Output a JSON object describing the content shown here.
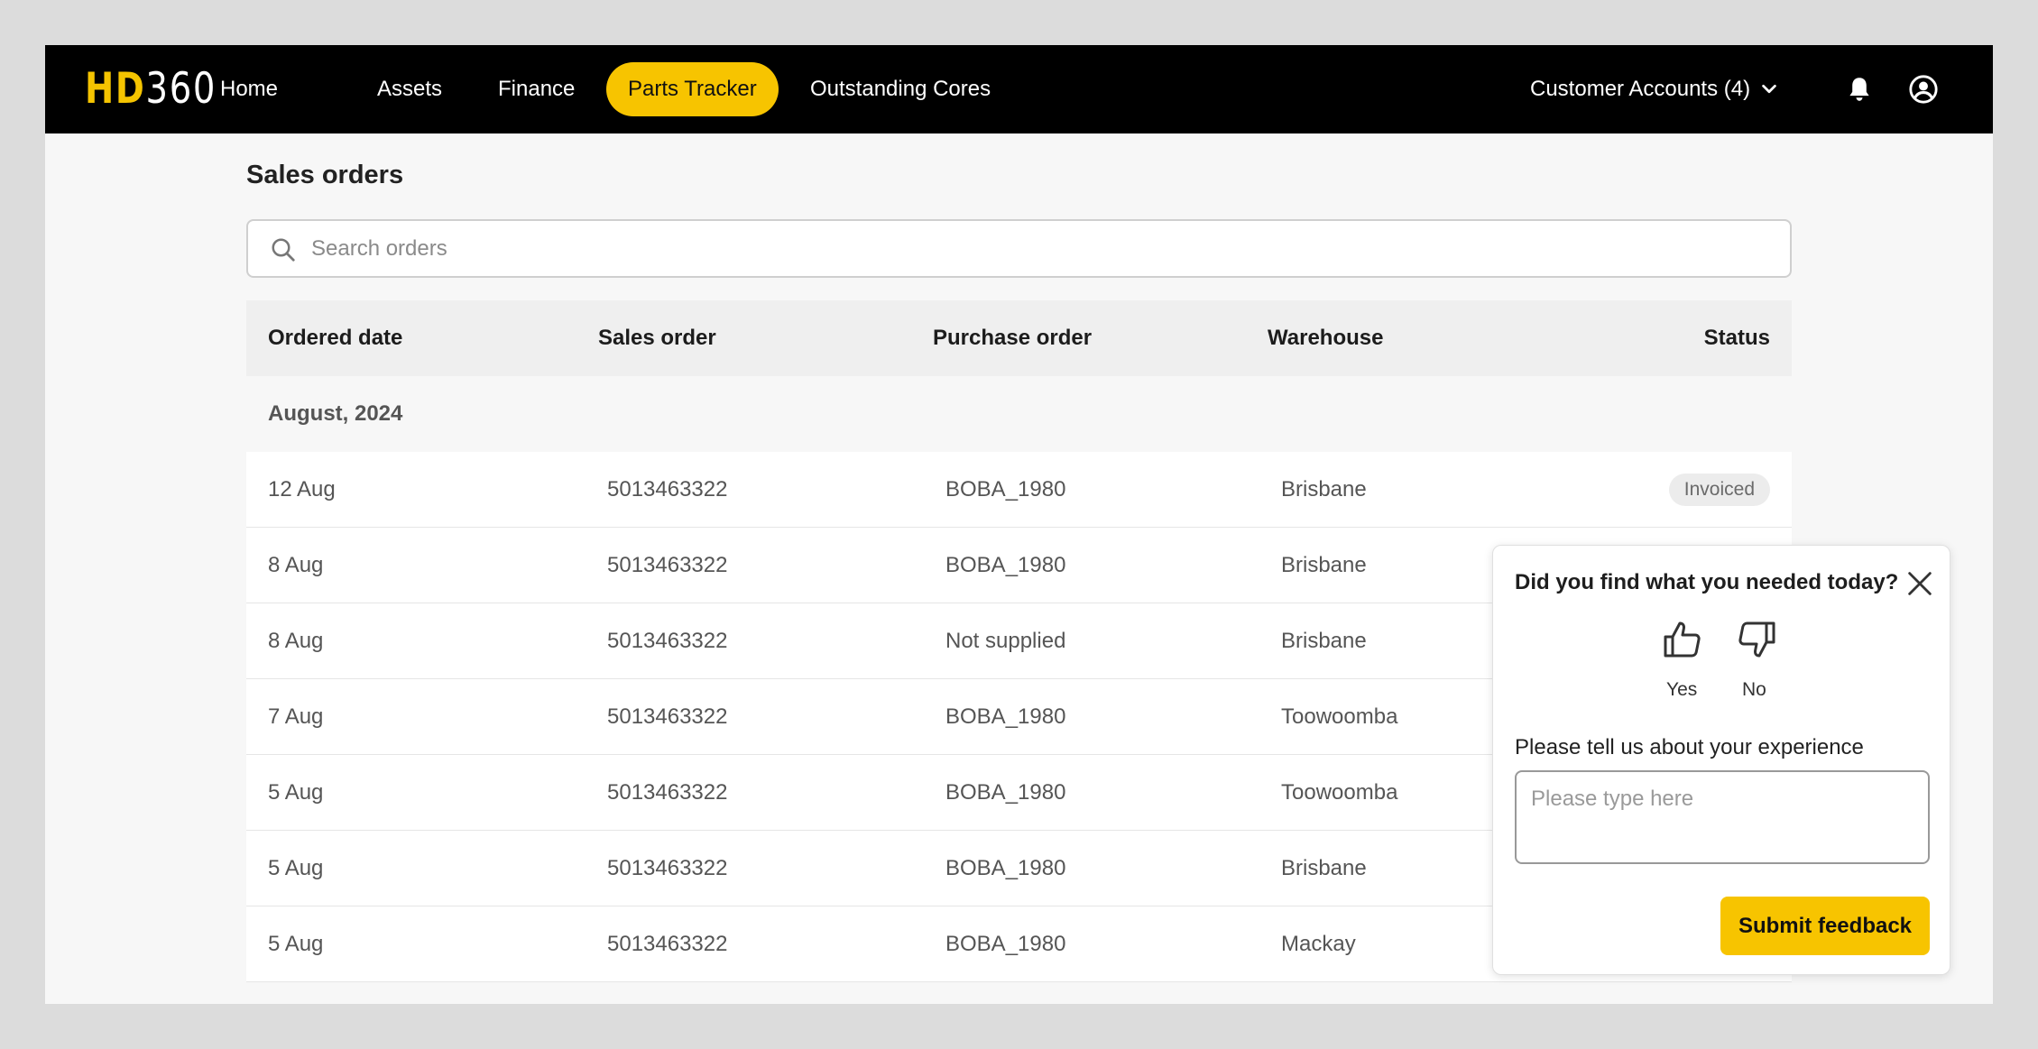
{
  "logo": {
    "prefix": "HD",
    "suffix": "360"
  },
  "nav": {
    "items": [
      {
        "label": "Home"
      },
      {
        "label": "Assets"
      },
      {
        "label": "Finance"
      },
      {
        "label": "Parts Tracker",
        "active": true
      },
      {
        "label": "Outstanding Cores"
      }
    ],
    "accounts_label": "Customer Accounts (4)",
    "icons": [
      "chevron-down-icon",
      "bell-icon",
      "user-circle-icon"
    ]
  },
  "page": {
    "title": "Sales orders",
    "search_placeholder": "Search orders"
  },
  "table": {
    "columns": [
      "Ordered date",
      "Sales order",
      "Purchase order",
      "Warehouse",
      "Status"
    ],
    "group": "August, 2024",
    "rows": [
      {
        "date": "12 Aug",
        "sales_order": "5013463322",
        "purchase_order": "BOBA_1980",
        "warehouse": "Brisbane",
        "status": "Invoiced"
      },
      {
        "date": "8 Aug",
        "sales_order": "5013463322",
        "purchase_order": "BOBA_1980",
        "warehouse": "Brisbane",
        "status": ""
      },
      {
        "date": "8 Aug",
        "sales_order": "5013463322",
        "purchase_order": "Not supplied",
        "warehouse": "Brisbane",
        "status": ""
      },
      {
        "date": "7 Aug",
        "sales_order": "5013463322",
        "purchase_order": "BOBA_1980",
        "warehouse": "Toowoomba",
        "status": ""
      },
      {
        "date": "5 Aug",
        "sales_order": "5013463322",
        "purchase_order": "BOBA_1980",
        "warehouse": "Toowoomba",
        "status": ""
      },
      {
        "date": "5 Aug",
        "sales_order": "5013463322",
        "purchase_order": "BOBA_1980",
        "warehouse": "Brisbane",
        "status": ""
      },
      {
        "date": "5 Aug",
        "sales_order": "5013463322",
        "purchase_order": "BOBA_1980",
        "warehouse": "Mackay",
        "status": ""
      }
    ]
  },
  "feedback": {
    "title": "Did you find what you needed today?",
    "yes_label": "Yes",
    "no_label": "No",
    "experience_label": "Please tell us about your experience",
    "input_placeholder": "Please type here",
    "submit_label": "Submit feedback"
  },
  "colors": {
    "accent": "#f7c400",
    "navbar": "#000000",
    "background": "#f7f7f7"
  }
}
